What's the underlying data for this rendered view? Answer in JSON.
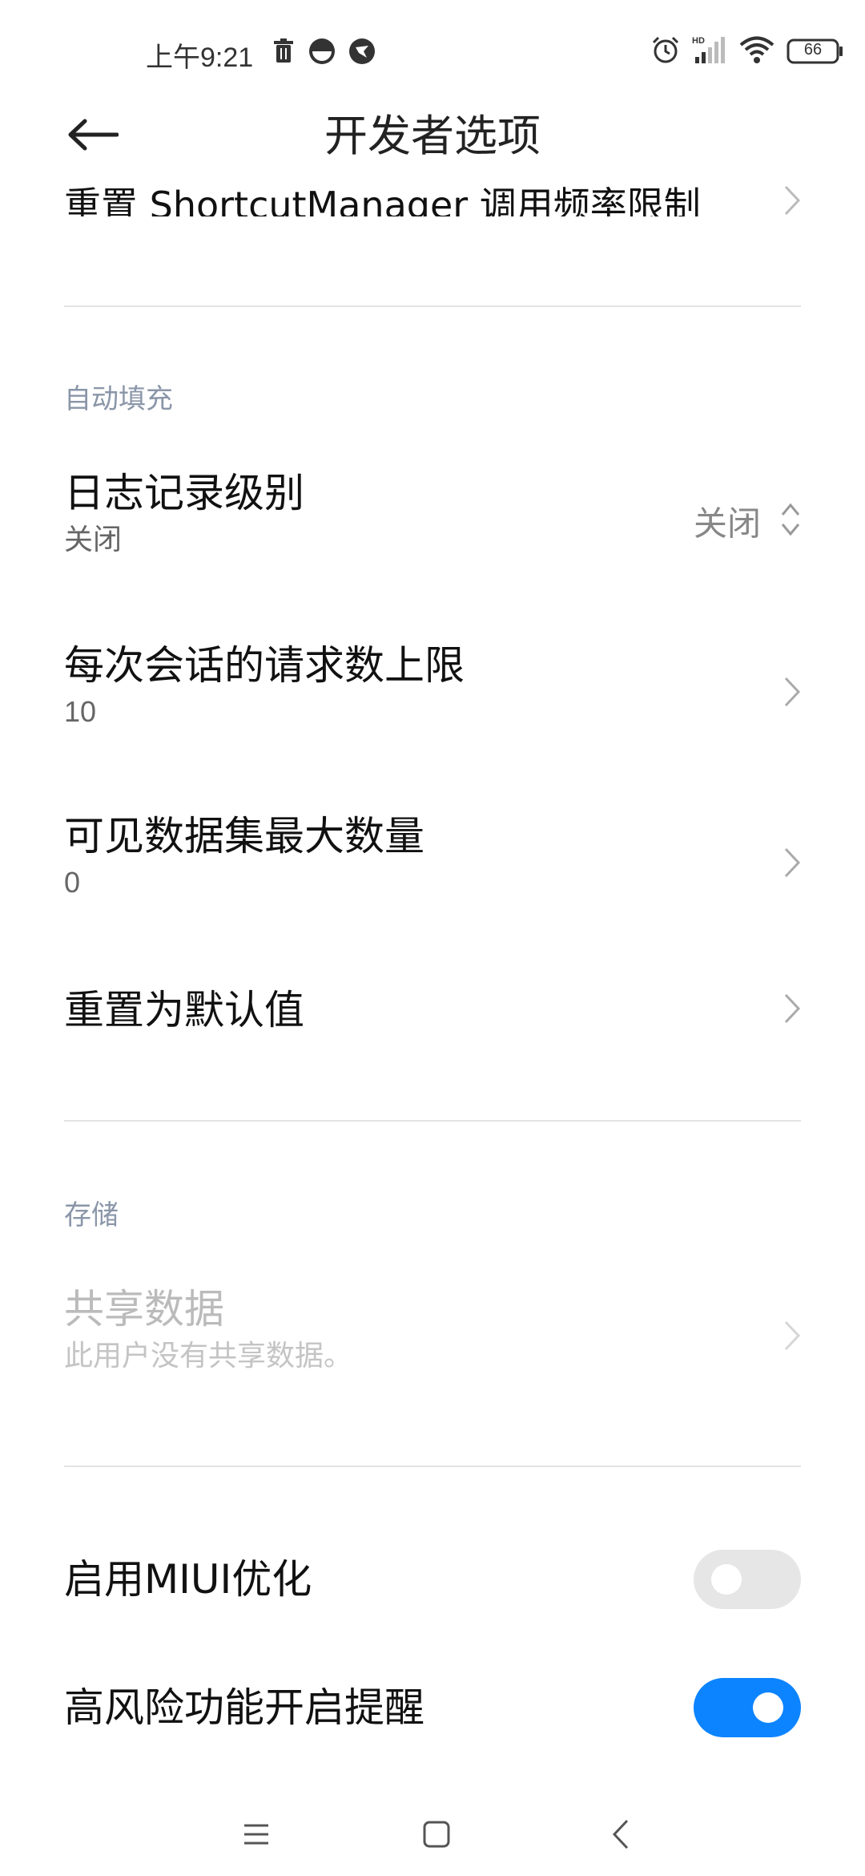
{
  "status_bar": {
    "time": "上午9:21",
    "icons_left": [
      "trash-icon",
      "app-circle-icon",
      "app-bird-icon"
    ],
    "icons_right": [
      "alarm-icon",
      "hd-signal-icon",
      "wifi-icon",
      "battery-icon"
    ],
    "battery_level": "66"
  },
  "header": {
    "title": "开发者选项",
    "back_icon": "arrow-left-icon"
  },
  "partial_item": {
    "title": "重置 ShortcutManager 调用频率限制"
  },
  "sections": {
    "autofill": {
      "header": "自动填充",
      "items": [
        {
          "title": "日志记录级别",
          "subtitle": "关闭",
          "value": "关闭",
          "control": "dropdown"
        },
        {
          "title": "每次会话的请求数上限",
          "subtitle": "10",
          "control": "chevron"
        },
        {
          "title": "可见数据集最大数量",
          "subtitle": "0",
          "control": "chevron"
        },
        {
          "title": "重置为默认值",
          "control": "chevron"
        }
      ]
    },
    "storage": {
      "header": "存储",
      "items": [
        {
          "title": "共享数据",
          "subtitle": "此用户没有共享数据。",
          "control": "chevron",
          "enabled": false
        }
      ]
    },
    "toggles": {
      "items": [
        {
          "title": "启用MIUI优化",
          "checked": false
        },
        {
          "title": "高风险功能开启提醒",
          "checked": true
        }
      ]
    }
  },
  "nav_bar": {
    "icons": [
      "menu-icon",
      "home-icon",
      "back-icon"
    ]
  },
  "colors": {
    "accent": "#0d84ff",
    "section_header": "#8a96a8",
    "divider": "#e3e3e3",
    "disabled_text": "#bbbbbb"
  }
}
